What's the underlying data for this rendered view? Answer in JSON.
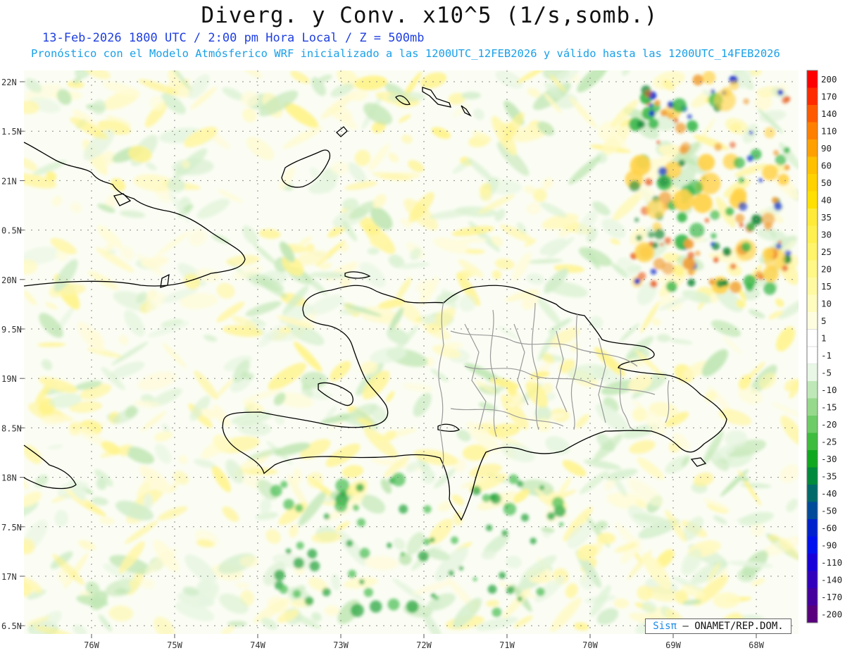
{
  "header": {
    "title": "Diverg. y Conv. x10^5 (1/s,somb.)",
    "line1": "13-Feb-2026  1800 UTC / 2:00 pm Hora Local / Z = 500mb",
    "line2": "Pronóstico con el Modelo Atmósferico WRF inicializado a las 1200UTC_12FEB2026 y válido hasta las  1200UTC_14FEB2026"
  },
  "axes": {
    "lat_labels": [
      "22N",
      "1.5N",
      "21N",
      "0.5N",
      "20N",
      "9.5N",
      "19N",
      "8.5N",
      "18N",
      "7.5N",
      "17N",
      "6.5N"
    ],
    "lon_labels": [
      "76W",
      "75W",
      "74W",
      "73W",
      "72W",
      "71W",
      "70W",
      "69W",
      "68W"
    ]
  },
  "colorbar": {
    "labels": [
      "200",
      "170",
      "140",
      "110",
      "90",
      "60",
      "50",
      "40",
      "35",
      "30",
      "25",
      "20",
      "15",
      "10",
      "5",
      "1",
      "-1",
      "-5",
      "-10",
      "-15",
      "-20",
      "-25",
      "-30",
      "-35",
      "-40",
      "-50",
      "-60",
      "-90",
      "-110",
      "-140",
      "-170",
      "-200"
    ],
    "colors": [
      "#ff0000",
      "#ff2a00",
      "#ff5a00",
      "#ff8000",
      "#ffa000",
      "#ffc000",
      "#ffd200",
      "#ffe000",
      "#ffea3a",
      "#fff050",
      "#fff46a",
      "#fff786",
      "#fffaa2",
      "#fffcc0",
      "#fffde0",
      "#ffffff",
      "#ffffff",
      "#e9f7e6",
      "#bfe8b8",
      "#96d98c",
      "#6dcc66",
      "#3ebc3e",
      "#10a81f",
      "#008a3c",
      "#006a6a",
      "#004a9a",
      "#0022cc",
      "#0010ee",
      "#1800d8",
      "#3200bc",
      "#45009e",
      "#58007e"
    ]
  },
  "credit": {
    "brand": "Sisπ",
    "text": "– ONAMET/REP.DOM."
  }
}
